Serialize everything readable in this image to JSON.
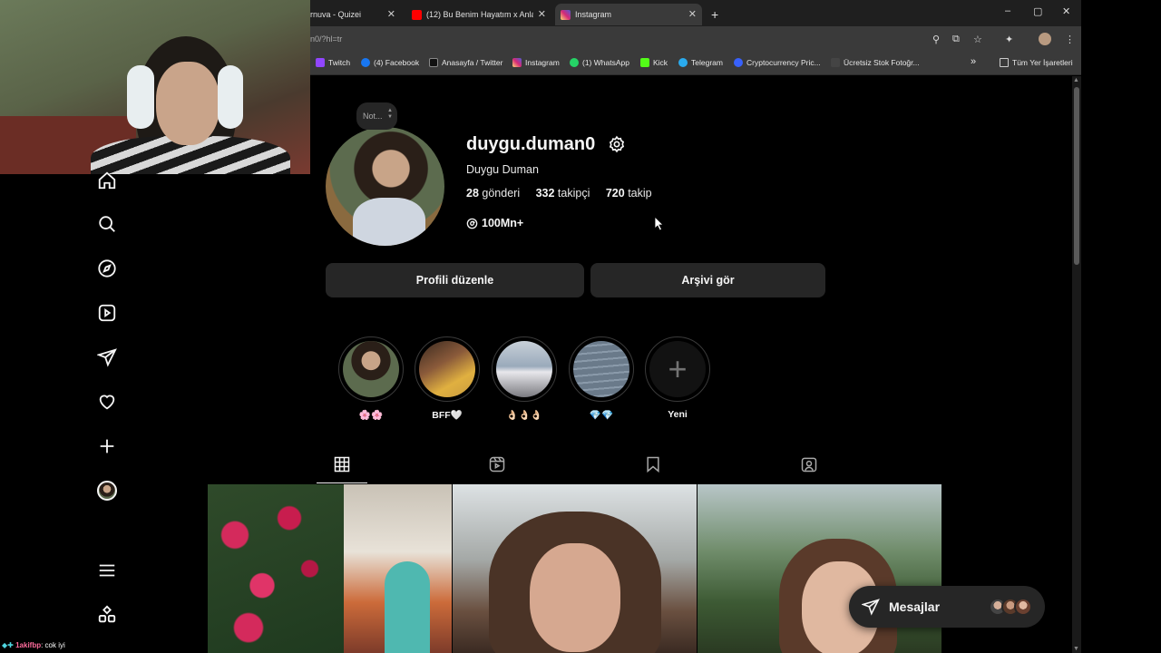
{
  "browser": {
    "tabs": [
      {
        "title": "rnuva - Quizei",
        "close": "✕"
      },
      {
        "title": "(12) Bu Benim Hayatım x Anlam",
        "close": "✕"
      },
      {
        "title": "Instagram",
        "close": "✕"
      }
    ],
    "new_tab": "+",
    "window_controls": {
      "minimize": "–",
      "maximize": "▢",
      "close": "✕"
    },
    "url": "n0/?hl=tr",
    "bookmarks": [
      {
        "label": "Twitch",
        "color": "#9146ff"
      },
      {
        "label": "(4) Facebook",
        "color": "#1877f2"
      },
      {
        "label": "Anasayfa / Twitter",
        "color": "#111111"
      },
      {
        "label": "Instagram",
        "color": "#e1306c"
      },
      {
        "label": "(1) WhatsApp",
        "color": "#25d366"
      },
      {
        "label": "Kick",
        "color": "#53fc18"
      },
      {
        "label": "Telegram",
        "color": "#2aabee"
      },
      {
        "label": "Cryptocurrency Pric...",
        "color": "#3861fb"
      },
      {
        "label": "Ücretsiz Stok Fotoğr...",
        "color": "#222222"
      }
    ],
    "bookmarks_overflow": "»",
    "all_bookmarks": "Tüm Yer İşaretleri"
  },
  "profile": {
    "note": "Not...",
    "username": "duygu.duman0",
    "full_name": "Duygu Duman",
    "posts_count": "28",
    "posts_label": "gönderi",
    "followers_count": "332",
    "followers_label": "takipçi",
    "following_count": "720",
    "following_label": "takip",
    "threads_label": "100Mn+",
    "edit_profile": "Profili düzenle",
    "view_archive": "Arşivi gör"
  },
  "highlights": [
    {
      "label": "🌸🌸",
      "color": "#8a9aa8"
    },
    {
      "label": "BFF🤍",
      "color": "#c08a3a"
    },
    {
      "label": "👌🏻👌🏻👌🏻",
      "color": "#9aaabb"
    },
    {
      "label": "💎💎",
      "color": "#6a7a8a"
    },
    {
      "label": "Yeni",
      "color": "#121212"
    }
  ],
  "messages": {
    "label": "Mesajlar"
  },
  "chat": {
    "user": "1akifbp",
    "text": ": cok iyi"
  },
  "colors": {
    "bg": "#000000",
    "button": "#262626",
    "text": "#f5f5f5",
    "muted": "#a8a8a8"
  }
}
